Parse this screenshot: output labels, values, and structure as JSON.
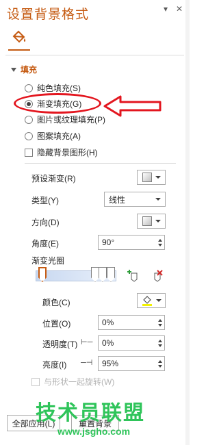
{
  "panel": {
    "title": "设置背景格式"
  },
  "tabs": {
    "fill_icon": "paint-bucket-icon"
  },
  "section": {
    "label": "填充"
  },
  "fill_options": [
    {
      "label": "纯色填充(S)",
      "selected": false
    },
    {
      "label": "渐变填充(G)",
      "selected": true
    },
    {
      "label": "图片或纹理填充(P)",
      "selected": false
    },
    {
      "label": "图案填充(A)",
      "selected": false
    }
  ],
  "hide_background": {
    "label": "隐藏背景图形(H)",
    "checked": false
  },
  "preset": {
    "label": "预设渐变(R)"
  },
  "type": {
    "label": "类型(Y)",
    "value": "线性"
  },
  "direction": {
    "label": "方向(D)"
  },
  "angle": {
    "label": "角度(E)",
    "value": "90°"
  },
  "stops": {
    "label": "渐变光圈"
  },
  "color": {
    "label": "颜色(C)"
  },
  "position": {
    "label": "位置(O)",
    "value": "0%"
  },
  "transparency": {
    "label": "透明度(T)",
    "value": "0%"
  },
  "brightness": {
    "label": "亮度(I)",
    "value": "95%"
  },
  "rotate_with_shape": {
    "label": "与形状一起旋转(W)",
    "checked": false,
    "disabled": true
  },
  "footer": {
    "apply_all": "全部应用(L)",
    "reset": "重置背景"
  },
  "watermark": {
    "line1": "技术员联盟",
    "line2": "www.jsgho.com"
  },
  "colors": {
    "accent": "#c55a11",
    "callout": "#e3161f",
    "watermark": "#2fc45a"
  }
}
